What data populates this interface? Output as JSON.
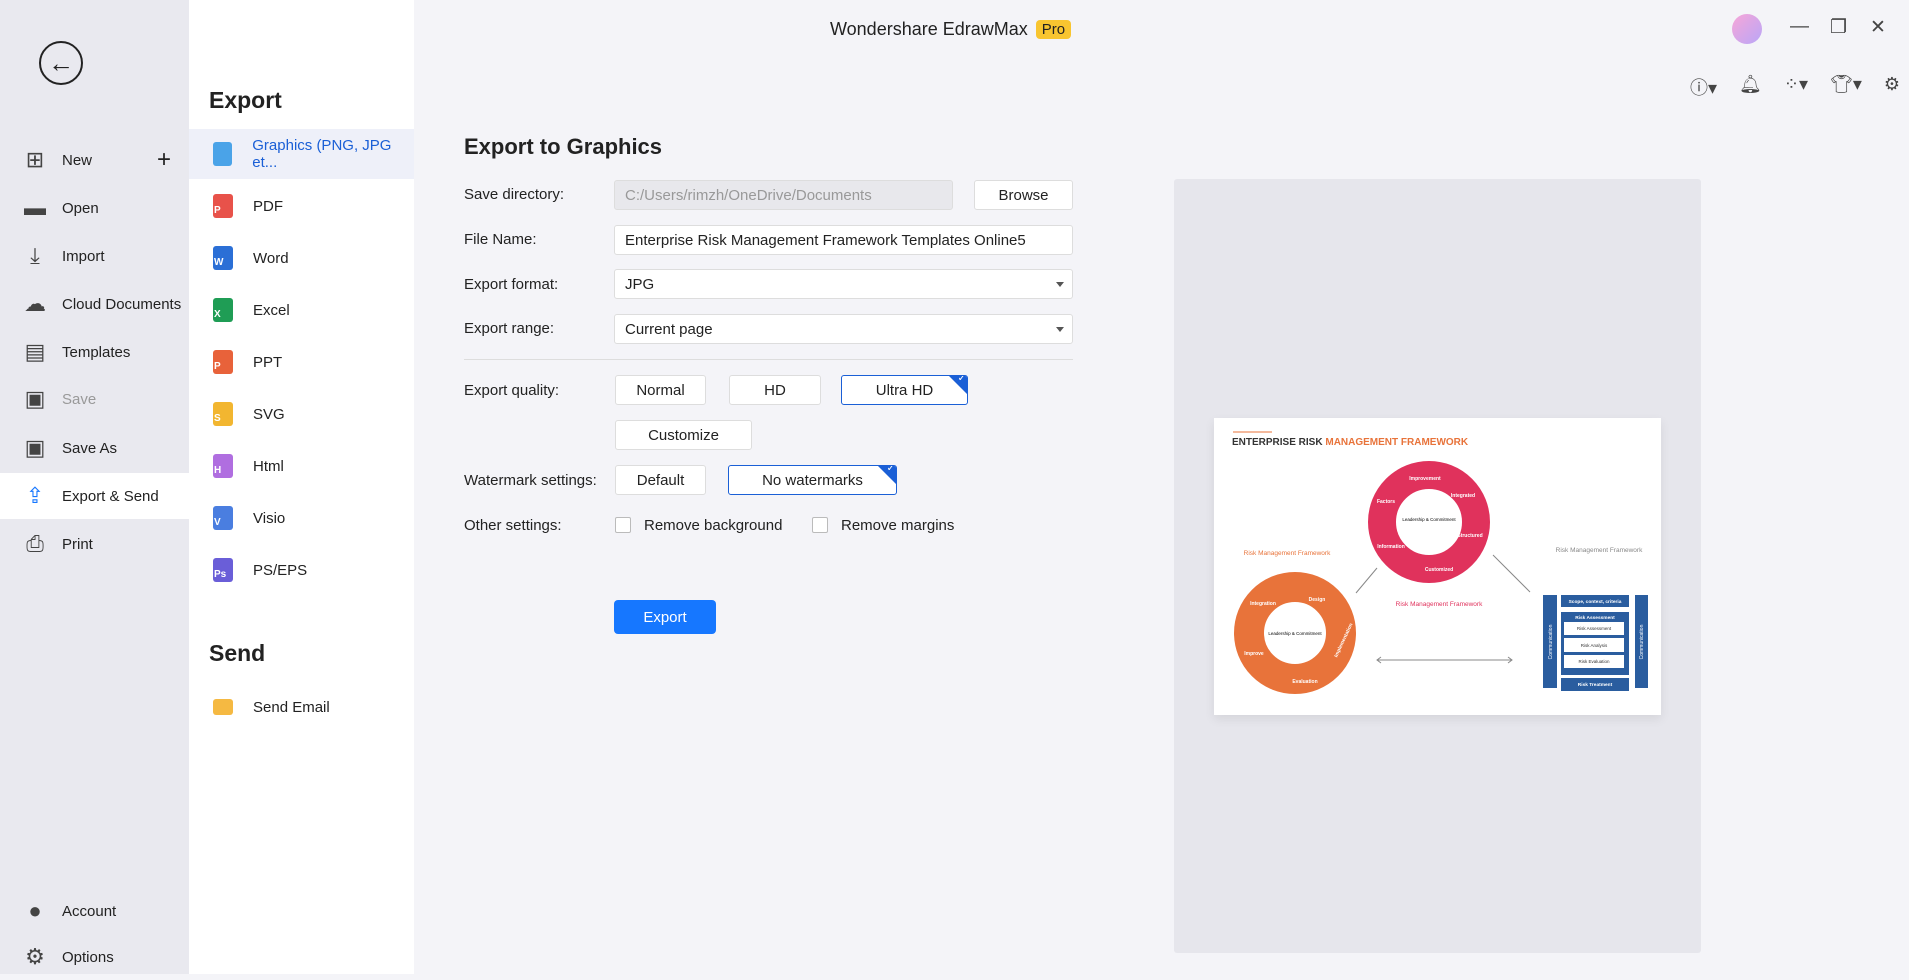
{
  "app": {
    "title": "Wondershare EdrawMax",
    "badge": "Pro"
  },
  "sidebar": {
    "items": [
      {
        "label": "New",
        "icon": "plus-square-icon"
      },
      {
        "label": "Open",
        "icon": "folder-icon"
      },
      {
        "label": "Import",
        "icon": "import-icon"
      },
      {
        "label": "Cloud Documents",
        "icon": "cloud-icon"
      },
      {
        "label": "Templates",
        "icon": "templates-icon"
      },
      {
        "label": "Save",
        "icon": "save-icon",
        "disabled": true
      },
      {
        "label": "Save As",
        "icon": "save-as-icon"
      },
      {
        "label": "Export & Send",
        "icon": "export-icon",
        "selected": true
      },
      {
        "label": "Print",
        "icon": "print-icon"
      }
    ],
    "bottom": [
      {
        "label": "Account",
        "icon": "account-icon"
      },
      {
        "label": "Options",
        "icon": "gear-icon"
      }
    ]
  },
  "export_panel": {
    "heading": "Export",
    "items": [
      {
        "label": "Graphics (PNG, JPG et...",
        "color": "#4aa3e8",
        "letter": ""
      },
      {
        "label": "PDF",
        "color": "#e8524a",
        "letter": "P"
      },
      {
        "label": "Word",
        "color": "#2b6fd6",
        "letter": "W"
      },
      {
        "label": "Excel",
        "color": "#1f9d55",
        "letter": "X"
      },
      {
        "label": "PPT",
        "color": "#e8623a",
        "letter": "P"
      },
      {
        "label": "SVG",
        "color": "#f2b630",
        "letter": "S"
      },
      {
        "label": "Html",
        "color": "#b06ee0",
        "letter": "H"
      },
      {
        "label": "Visio",
        "color": "#4a7ee0",
        "letter": "V"
      },
      {
        "label": "PS/EPS",
        "color": "#6a5ed8",
        "letter": "Ps"
      }
    ],
    "send_heading": "Send",
    "send_items": [
      {
        "label": "Send Email",
        "color": "#f5b942"
      }
    ]
  },
  "form": {
    "title": "Export to Graphics",
    "save_directory": {
      "label": "Save directory:",
      "value": "C:/Users/rimzh/OneDrive/Documents",
      "browse": "Browse"
    },
    "file_name": {
      "label": "File Name:",
      "value": "Enterprise Risk Management Framework Templates Online5"
    },
    "format": {
      "label": "Export format:",
      "value": "JPG"
    },
    "range": {
      "label": "Export range:",
      "value": "Current page"
    },
    "quality": {
      "label": "Export quality:",
      "options": [
        "Normal",
        "HD",
        "Ultra HD"
      ],
      "selected": "Ultra HD",
      "customize": "Customize"
    },
    "watermark": {
      "label": "Watermark settings:",
      "options": [
        "Default",
        "No watermarks"
      ],
      "selected": "No watermarks"
    },
    "other": {
      "label": "Other settings:",
      "remove_background": "Remove background",
      "remove_margins": "Remove margins"
    },
    "export_button": "Export"
  },
  "preview": {
    "title_dark": "ENTERPRISE RISK",
    "title_accent": "MANAGEMENT FRAMEWORK",
    "center": "Leadership & Commitment",
    "red_labels": [
      "Improvement",
      "Integrated",
      "Structured",
      "Customized",
      "Information",
      "Factors"
    ],
    "orange_labels": [
      "Integration",
      "Design",
      "Implementation",
      "Evaluation",
      "Improve"
    ],
    "caption": "Risk Management Framework",
    "box": [
      "Scope, context, criteria",
      "Risk Assessment",
      "Risk Assessment",
      "Risk Analysis",
      "Risk Evaluation",
      "Risk Treatment",
      "Communication"
    ]
  },
  "colors": {
    "accent": "#1677ff",
    "red": "#e0325c",
    "orange": "#e8733a",
    "navy": "#2a5d9f"
  }
}
